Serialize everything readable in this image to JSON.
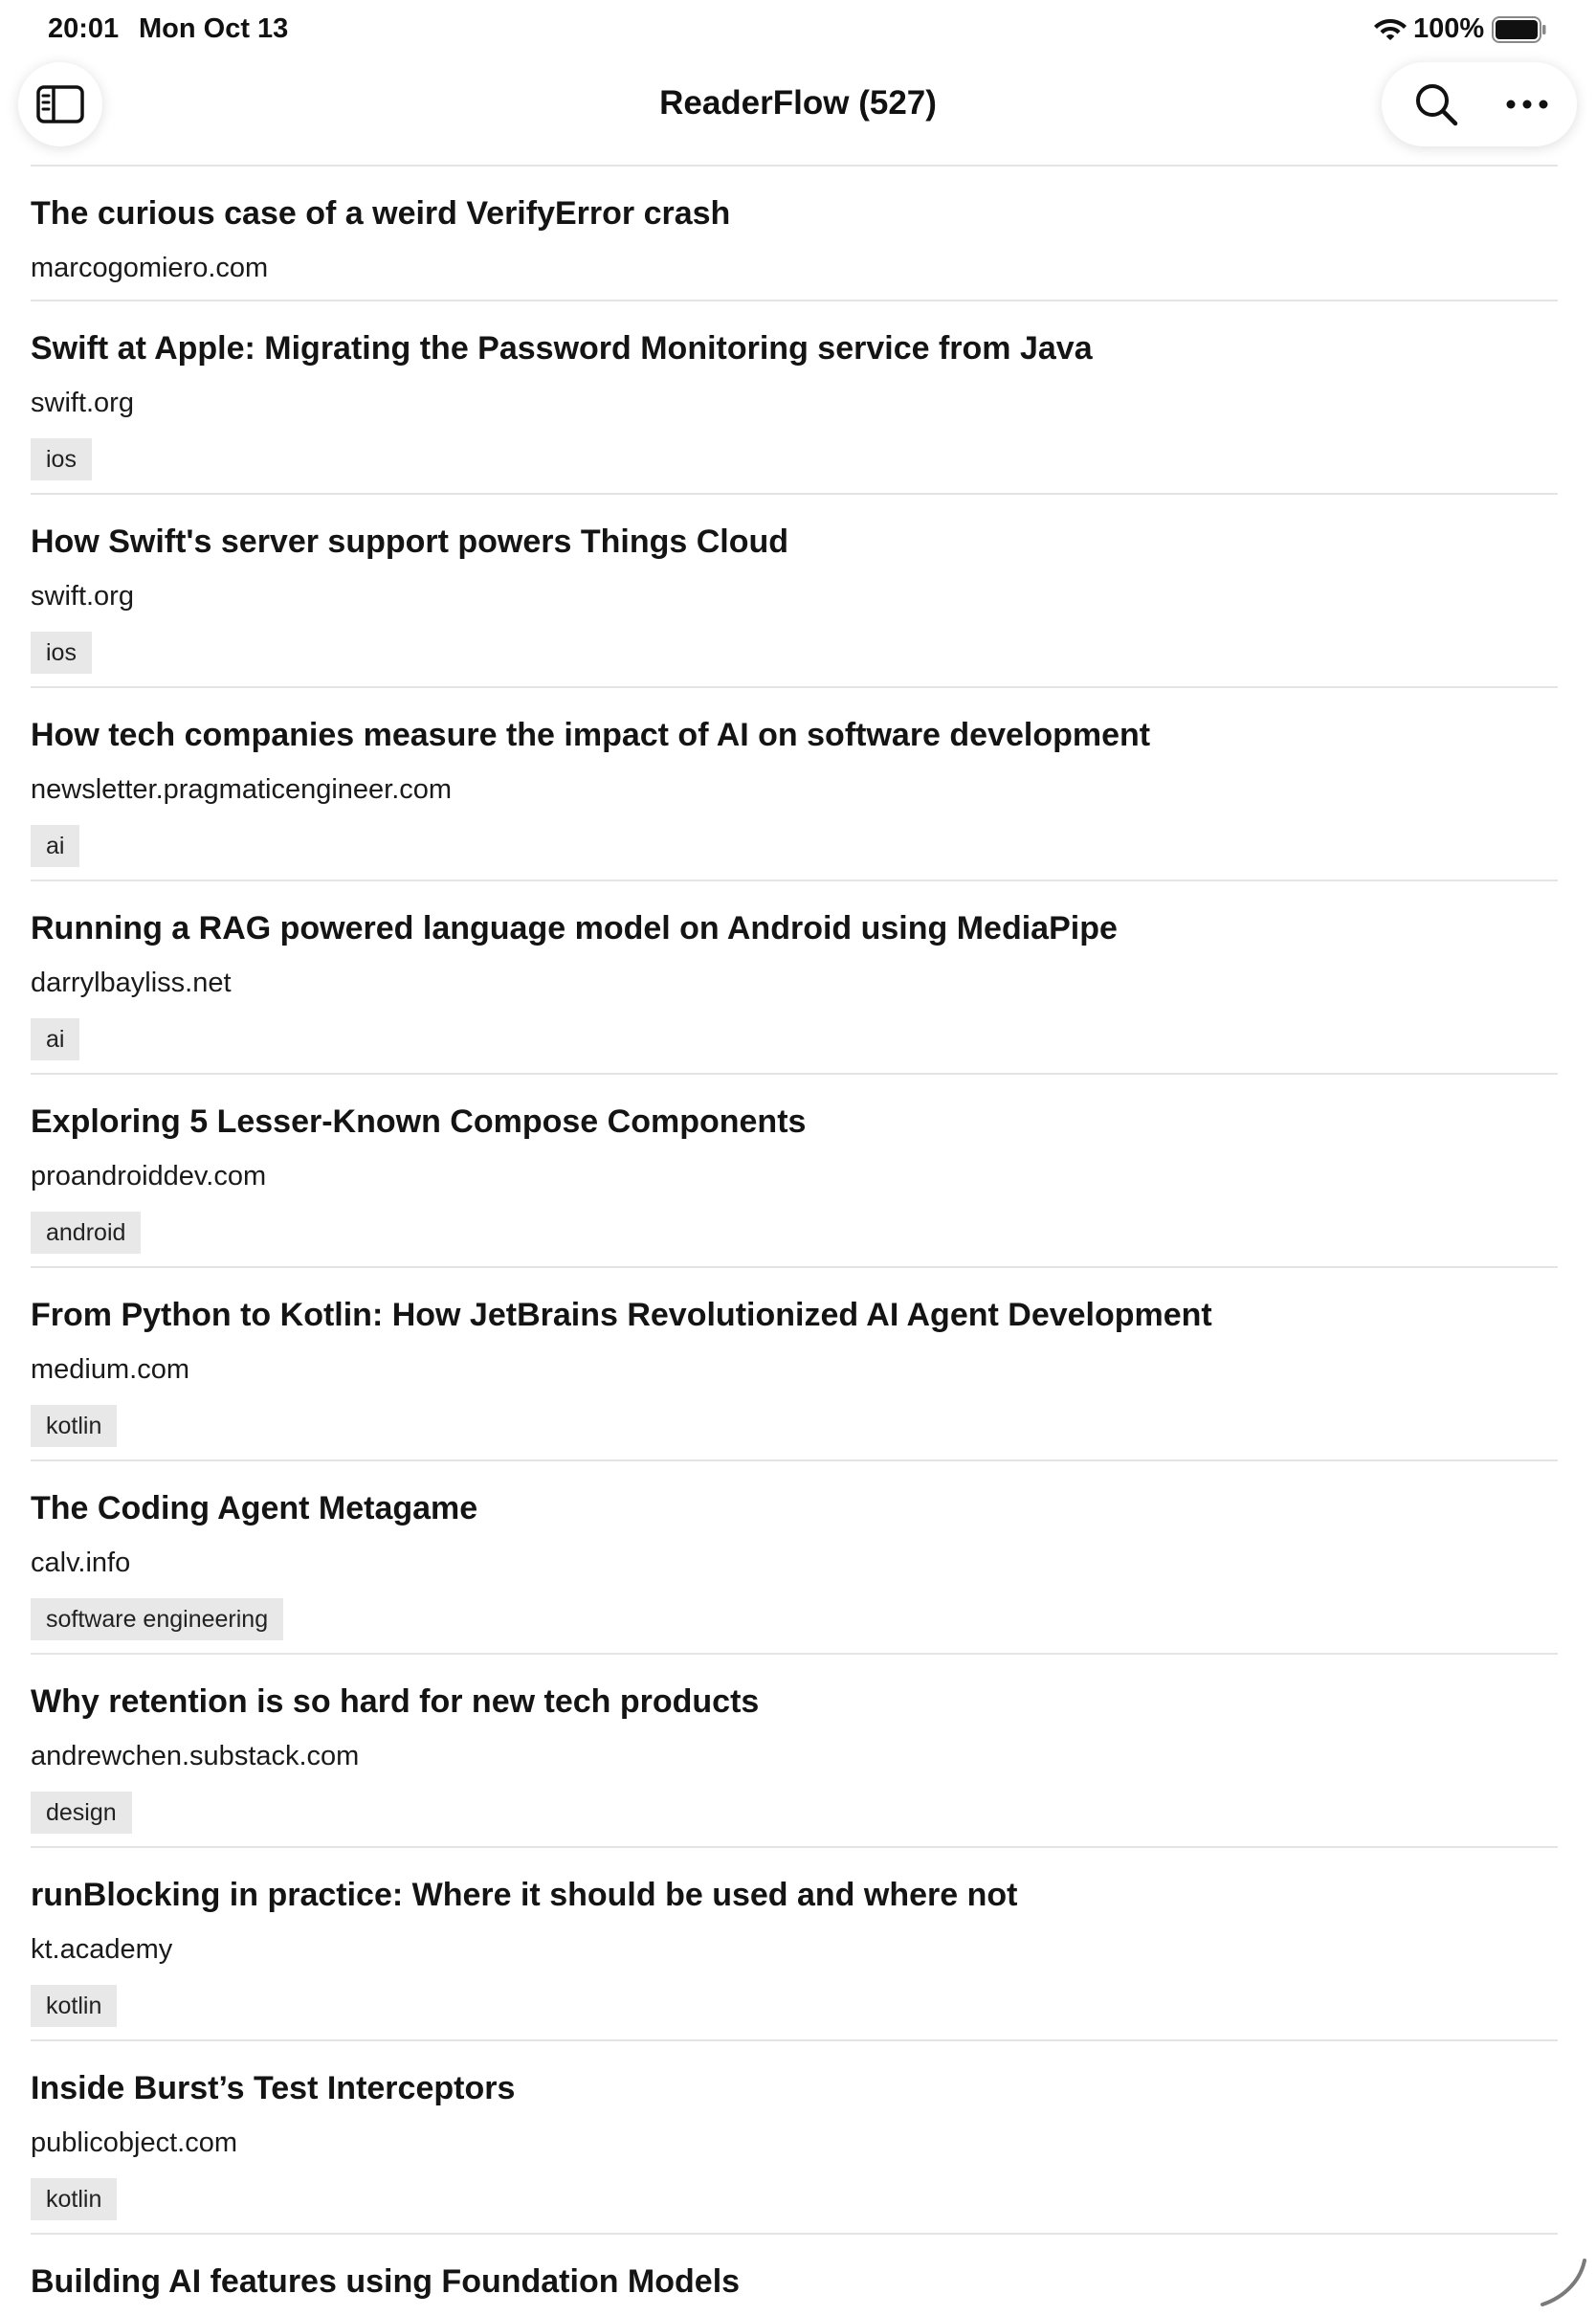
{
  "status_bar": {
    "time": "20:01",
    "date": "Mon Oct 13",
    "battery_percent": "100%",
    "icons": [
      "wifi-icon",
      "battery-icon"
    ]
  },
  "nav": {
    "title": "ReaderFlow (527)",
    "sidebar_icon": "sidebar-icon",
    "search_icon": "search-icon",
    "more_icon": "ellipsis-icon"
  },
  "articles": [
    {
      "title": "The curious case of a weird VerifyError crash",
      "source": "marcogomiero.com",
      "tag": ""
    },
    {
      "title": "Swift at Apple: Migrating the Password Monitoring service from Java",
      "source": "swift.org",
      "tag": "ios"
    },
    {
      "title": "How Swift's server support powers Things Cloud",
      "source": "swift.org",
      "tag": "ios"
    },
    {
      "title": "How tech companies measure the impact of AI on software development",
      "source": "newsletter.pragmaticengineer.com",
      "tag": "ai"
    },
    {
      "title": "Running a RAG powered language model on Android using MediaPipe",
      "source": "darrylbayliss.net",
      "tag": "ai"
    },
    {
      "title": "Exploring 5 Lesser-Known Compose Components",
      "source": "proandroiddev.com",
      "tag": "android"
    },
    {
      "title": "From Python to Kotlin: How JetBrains Revolutionized AI Agent Development",
      "source": "medium.com",
      "tag": "kotlin"
    },
    {
      "title": "The Coding Agent Metagame",
      "source": "calv.info",
      "tag": "software engineering"
    },
    {
      "title": "Why retention is so hard for new tech products",
      "source": "andrewchen.substack.com",
      "tag": "design"
    },
    {
      "title": "runBlocking in practice: Where it should be used and where not",
      "source": "kt.academy",
      "tag": "kotlin"
    },
    {
      "title": "Inside Burst’s Test Interceptors",
      "source": "publicobject.com",
      "tag": "kotlin"
    },
    {
      "title": "Building AI features using Foundation Models",
      "source": "",
      "tag": ""
    }
  ],
  "colors": {
    "background": "#ffffff",
    "divider": "#e4e4e4",
    "tag_background": "#e8e8e8",
    "text": "#141414"
  }
}
